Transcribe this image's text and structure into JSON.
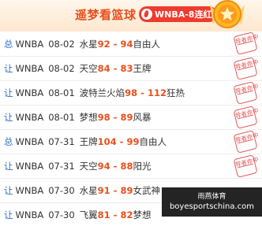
{
  "header": {
    "title": "遥梦看篮球",
    "streak_label": "WNBA-8连红",
    "colors": {
      "accent": "#e8501c",
      "pill": "#ef3b2d",
      "tag": "#2f6fc2",
      "stamp": "#e15a5a"
    }
  },
  "rows": [
    {
      "tag": "总",
      "league": "WNBA",
      "date": "08-02",
      "home": "水星",
      "home_score": "92",
      "away_score": "94",
      "away": "自由人",
      "stamp": "荐者命中"
    },
    {
      "tag": "让",
      "league": "WNBA",
      "date": "08-02",
      "home": "天空",
      "home_score": "84",
      "away_score": "83",
      "away": "王牌",
      "stamp": "荐者命中"
    },
    {
      "tag": "让",
      "league": "WNBA",
      "date": "08-01",
      "home": "波特兰火焰",
      "home_score": "98",
      "away_score": "112",
      "away": "狂热",
      "stamp": "荐者命中"
    },
    {
      "tag": "让",
      "league": "WNBA",
      "date": "08-01",
      "home": "梦想",
      "home_score": "98",
      "away_score": "89",
      "away": "风暴",
      "stamp": "荐者命中"
    },
    {
      "tag": "总",
      "league": "WNBA",
      "date": "07-31",
      "home": "王牌",
      "home_score": "104",
      "away_score": "99",
      "away": "自由人",
      "stamp": "荐者命中"
    },
    {
      "tag": "让",
      "league": "WNBA",
      "date": "07-31",
      "home": "天空",
      "home_score": "94",
      "away_score": "88",
      "away": "阳光",
      "stamp": "荐者命中"
    },
    {
      "tag": "让",
      "league": "WNBA",
      "date": "07-30",
      "home": "水星",
      "home_score": "91",
      "away_score": "89",
      "away": "女武神",
      "stamp": "荐者命中"
    },
    {
      "tag": "让",
      "league": "WNBA",
      "date": "07-30",
      "home": "飞翼",
      "home_score": "81",
      "away_score": "82",
      "away": "梦想",
      "stamp": "荐者命中"
    }
  ],
  "watermark": {
    "line1": "雨燕体育",
    "line2": "boyesportschina.com"
  }
}
